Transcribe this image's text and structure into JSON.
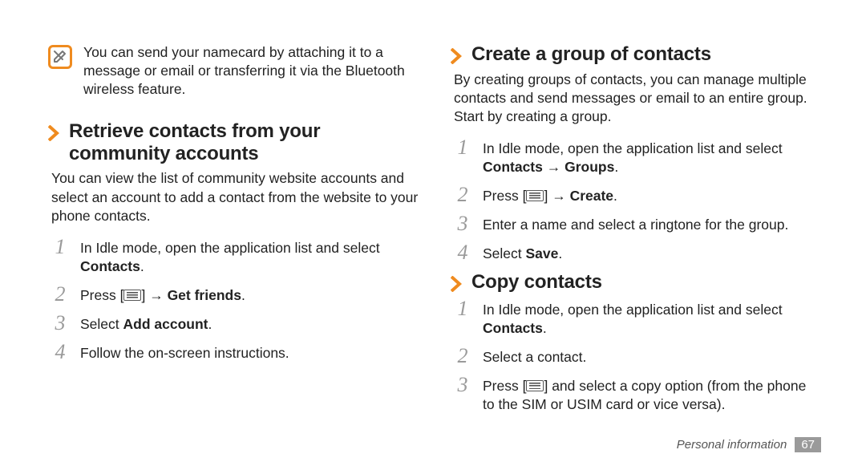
{
  "tip": {
    "icon_glyph": "✓",
    "text": "You can send your namecard by attaching it to a message or email or transferring it via the Bluetooth wireless feature."
  },
  "left": {
    "heading": "Retrieve contacts from your community accounts",
    "body": "You can view the list of community website accounts and select an account to add a contact from the website to your phone contacts.",
    "steps": [
      {
        "n": "1",
        "pre": "In Idle mode, open the application list and select ",
        "bold": "Contacts",
        "post": "."
      },
      {
        "n": "2",
        "pre": "Press [",
        "menu": true,
        "mid": "] → ",
        "bold": "Get friends",
        "post": "."
      },
      {
        "n": "3",
        "pre": "Select ",
        "bold": "Add account",
        "post": "."
      },
      {
        "n": "4",
        "pre": "Follow the on-screen instructions.",
        "bold": "",
        "post": ""
      }
    ]
  },
  "right1": {
    "heading": "Create a group of contacts",
    "body": "By creating groups of contacts, you can manage multiple contacts and send messages or email to an entire group. Start by creating a group.",
    "steps": [
      {
        "n": "1",
        "pre": "In Idle mode, open the application list and select ",
        "bold": "Contacts → Groups",
        "post": "."
      },
      {
        "n": "2",
        "pre": "Press [",
        "menu": true,
        "mid": "] → ",
        "bold": "Create",
        "post": "."
      },
      {
        "n": "3",
        "pre": "Enter a name and select a ringtone for the group.",
        "bold": "",
        "post": ""
      },
      {
        "n": "4",
        "pre": "Select ",
        "bold": "Save",
        "post": "."
      }
    ]
  },
  "right2": {
    "heading": "Copy contacts",
    "steps": [
      {
        "n": "1",
        "pre": "In Idle mode, open the application list and select ",
        "bold": "Contacts",
        "post": "."
      },
      {
        "n": "2",
        "pre": "Select a contact.",
        "bold": "",
        "post": ""
      },
      {
        "n": "3",
        "pre": "Press [",
        "menu": true,
        "mid": "] and select a copy option (from the phone to the SIM or USIM card or vice versa).",
        "bold": "",
        "post": ""
      }
    ]
  },
  "footer": {
    "section": "Personal information",
    "page": "67"
  }
}
